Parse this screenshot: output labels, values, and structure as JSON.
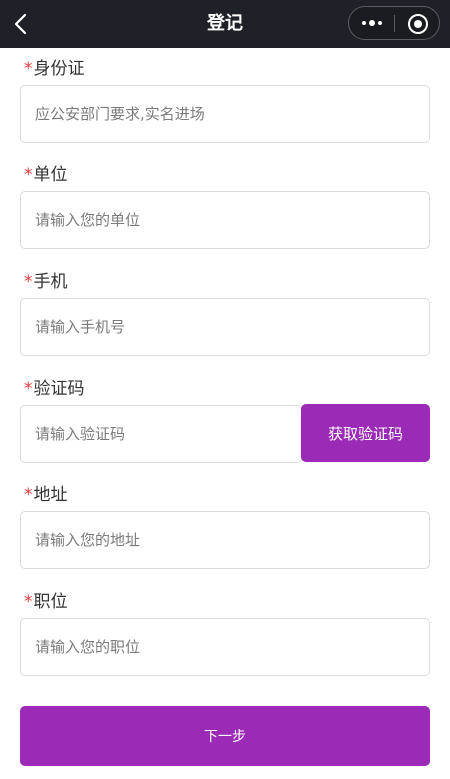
{
  "nav": {
    "title": "登记",
    "back_icon": "chevron-left-icon",
    "more_icon": "more-dots-icon",
    "close_icon": "mini-program-close-icon",
    "background": "#1f2129"
  },
  "required_mark": "*",
  "fields": {
    "id_card": {
      "label": "身份证",
      "placeholder": "应公安部门要求,实名进场",
      "value": ""
    },
    "company": {
      "label": "单位",
      "placeholder": "请输入您的单位",
      "value": ""
    },
    "phone": {
      "label": "手机",
      "placeholder": "请输入手机号",
      "value": ""
    },
    "code": {
      "label": "验证码",
      "placeholder": "请输入验证码",
      "value": ""
    },
    "address": {
      "label": "地址",
      "placeholder": "请输入您的地址",
      "value": ""
    },
    "position": {
      "label": "职位",
      "placeholder": "请输入您的职位",
      "value": ""
    }
  },
  "get_code_button": "获取验证码",
  "next_button": "下一步",
  "colors": {
    "accent": "#9b2bb6",
    "required": "#e23b3b",
    "border": "#dddddd"
  }
}
